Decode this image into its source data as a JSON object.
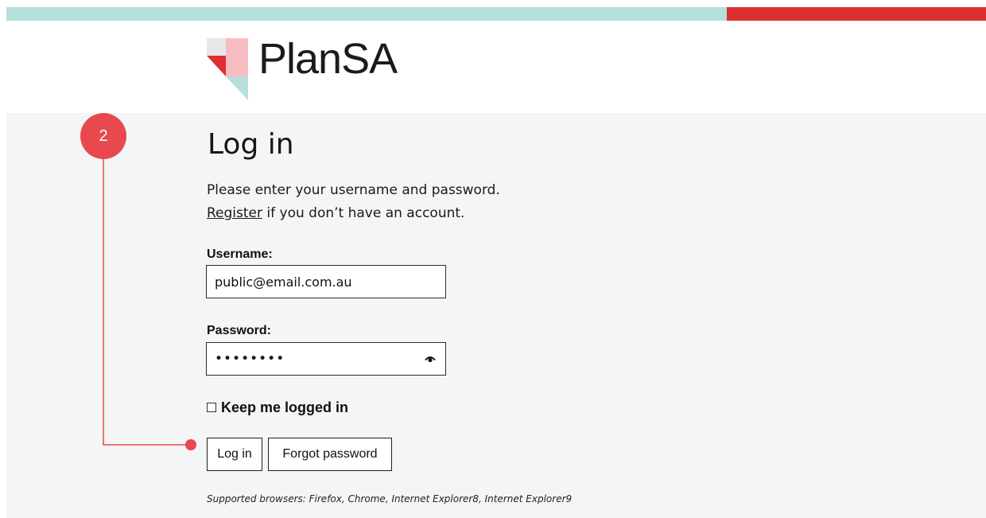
{
  "brand": {
    "name": "PlanSA",
    "accent_teal": "#b6e0db",
    "accent_red": "#db2f30",
    "logo_colors": [
      "#e8e8e8",
      "#f6bcc2",
      "#db2f30",
      "#b6e0db"
    ]
  },
  "login": {
    "title": "Log in",
    "intro_line1": "Please enter your username and password.",
    "register_link": "Register",
    "intro_line2_suffix": " if you don’t have an account.",
    "username_label": "Username:",
    "username_value": "public@email.com.au",
    "password_label": "Password:",
    "password_value": "password",
    "show_password_icon": "eye-icon",
    "keep_logged_in_label": "Keep me logged in",
    "keep_logged_in_checked": false,
    "login_button": "Log in",
    "forgot_button": "Forgot password",
    "supported_browsers": "Supported browsers: Firefox, Chrome, Internet Explorer8, Internet Explorer9"
  },
  "annotation": {
    "step_number": "2",
    "color": "#e8494f"
  }
}
